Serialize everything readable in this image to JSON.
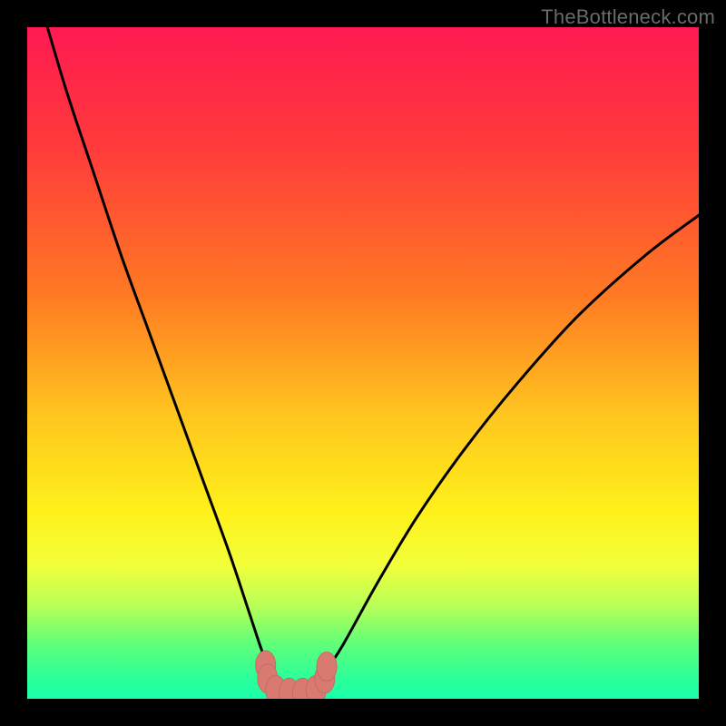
{
  "watermark": "TheBottleneck.com",
  "colors": {
    "frame": "#000000",
    "gradient_stops": [
      {
        "offset": 0.0,
        "color": "#ff1a52"
      },
      {
        "offset": 0.18,
        "color": "#ff3b3b"
      },
      {
        "offset": 0.4,
        "color": "#ff7a23"
      },
      {
        "offset": 0.58,
        "color": "#ffc61f"
      },
      {
        "offset": 0.72,
        "color": "#fff01a"
      },
      {
        "offset": 0.8,
        "color": "#f3ff3a"
      },
      {
        "offset": 0.86,
        "color": "#baff56"
      },
      {
        "offset": 0.92,
        "color": "#5eff7a"
      },
      {
        "offset": 0.97,
        "color": "#2bff9a"
      },
      {
        "offset": 1.0,
        "color": "#19ffa8"
      }
    ],
    "curve": "#000000",
    "marker_fill": "#d97a72",
    "marker_stroke": "#c96a62"
  },
  "chart_data": {
    "type": "line",
    "title": "",
    "xlabel": "",
    "ylabel": "",
    "xlim": [
      0,
      100
    ],
    "ylim": [
      0,
      100
    ],
    "series": [
      {
        "name": "bottleneck-curve",
        "x": [
          3,
          6,
          10,
          14,
          18,
          22,
          26,
          30,
          33,
          35,
          36.5,
          38,
          40,
          42,
          44,
          47,
          52,
          58,
          65,
          73,
          82,
          92,
          100
        ],
        "y": [
          100,
          90,
          78,
          66,
          55,
          44,
          33,
          22,
          13,
          7,
          3.5,
          1.3,
          1.0,
          1.3,
          3.5,
          8,
          17,
          27,
          37,
          47,
          57,
          66,
          72
        ]
      }
    ],
    "markers": [
      {
        "x": 35.5,
        "y": 5.0
      },
      {
        "x": 35.8,
        "y": 3.0
      },
      {
        "x": 37.0,
        "y": 1.3
      },
      {
        "x": 39.0,
        "y": 0.9
      },
      {
        "x": 41.0,
        "y": 0.9
      },
      {
        "x": 43.0,
        "y": 1.3
      },
      {
        "x": 44.3,
        "y": 3.0
      },
      {
        "x": 44.6,
        "y": 4.8
      }
    ]
  }
}
